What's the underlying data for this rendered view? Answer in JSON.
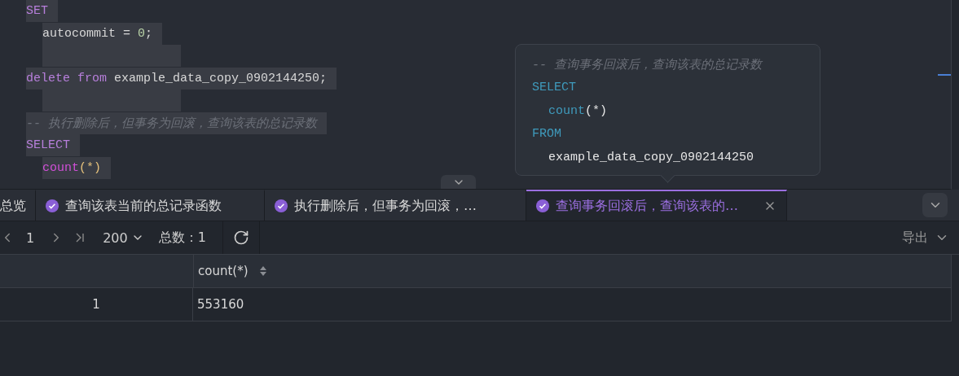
{
  "editor": {
    "lines": [
      {
        "indent": false,
        "highlighted": true,
        "tokens": [
          {
            "text": "SET",
            "kind": "keyword"
          }
        ]
      },
      {
        "indent": true,
        "highlighted": true,
        "tokens": [
          {
            "text": "autocommit",
            "kind": "ident"
          },
          {
            "text": " = ",
            "kind": "punct"
          },
          {
            "text": "0",
            "kind": "number"
          },
          {
            "text": ";",
            "kind": "punct"
          }
        ]
      },
      {
        "indent": true,
        "highlighted": true
      },
      {
        "indent": false,
        "highlighted": true,
        "tokens": [
          {
            "text": "delete",
            "kind": "keyword"
          },
          {
            "text": " from",
            "kind": "keyword"
          },
          {
            "text": " example_data_copy_0902144250;",
            "kind": "ident"
          }
        ]
      },
      {
        "indent": true,
        "highlighted": true
      },
      {
        "indent": false,
        "highlighted": true,
        "tokens": [
          {
            "text": "-- 执行删除后，但事务为回滚，查询该表的总记录数",
            "kind": "comment"
          }
        ]
      },
      {
        "indent": false,
        "highlighted": true,
        "tokens": [
          {
            "text": "SELECT",
            "kind": "keyword"
          }
        ]
      },
      {
        "indent": true,
        "highlighted": true,
        "tokens": [
          {
            "text": "count",
            "kind": "func"
          },
          {
            "text": "(*)",
            "kind": "paren"
          }
        ]
      }
    ]
  },
  "tooltip": {
    "lines": [
      {
        "indent": false,
        "tokens": [
          {
            "text": "-- 查询事务回滚后，查询该表的总记录数",
            "kind": "comment"
          }
        ]
      },
      {
        "indent": false,
        "tokens": [
          {
            "text": "SELECT",
            "kind": "keyword"
          }
        ]
      },
      {
        "indent": true,
        "tokens": [
          {
            "text": "count",
            "kind": "func"
          },
          {
            "text": "(*)",
            "kind": "punct"
          }
        ]
      },
      {
        "indent": false,
        "tokens": [
          {
            "text": "FROM",
            "kind": "keyword"
          }
        ]
      },
      {
        "indent": true,
        "tokens": [
          {
            "text": "example_data_copy_0902144250",
            "kind": "ident"
          }
        ]
      }
    ]
  },
  "tabs": [
    {
      "label": "总览",
      "kind": "overview",
      "selected": false
    },
    {
      "label": "查询该表当前的总记录函数",
      "kind": "query",
      "selected": false
    },
    {
      "label": "执行删除后，但事务为回滚，…",
      "kind": "query",
      "selected": false
    },
    {
      "label": "查询事务回滚后，查询该表的…",
      "kind": "query",
      "selected": true
    }
  ],
  "toolbar": {
    "page": "1",
    "page_size": "200",
    "total": "总数：1",
    "export": "导出"
  },
  "table": {
    "columns": [
      {
        "label": "count(*)",
        "sortable": true
      }
    ],
    "rows": [
      {
        "index": "1",
        "cells": [
          "553160"
        ]
      }
    ]
  }
}
